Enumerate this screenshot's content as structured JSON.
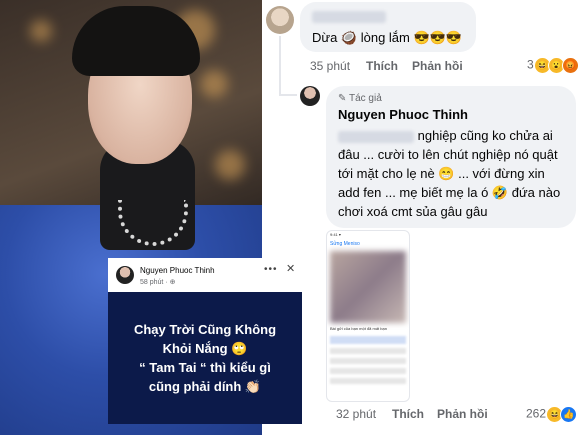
{
  "post_card": {
    "author": "Nguyen Phuoc Thinh",
    "time": "58 phút · ⊕",
    "dots": "•••",
    "close": "✕",
    "banner_lines": [
      "Chạy Trời Cũng Không",
      "Khỏi Nắng 🙄",
      "“ Tam Tai “ thì kiểu gì",
      "cũng phải dính 👏🏻"
    ]
  },
  "comment1": {
    "text": "Dừa 🥥 lòng lắm 😎😎😎",
    "time": "35 phút",
    "like": "Thích",
    "reply": "Phản hồi",
    "react_count": "3",
    "react_emojis": [
      "😆",
      "😮",
      "😡"
    ]
  },
  "comment2": {
    "badge": "✎ Tác giả",
    "author": "Nguyen Phuoc Thinh",
    "lines": [
      "nghiệp cũng ko chửa ai",
      "đâu ... cười to lên chút nghiệp nó quật",
      "tới mặt cho lẹ nè 😁 ... với đừng xin",
      "add fen ... mẹ biết mẹ la ó 🤣 đứa nào",
      "chơi xoá cmt sủa gâu gâu"
    ],
    "time": "32 phút",
    "like": "Thích",
    "reply": "Phản hồi",
    "react_count": "262",
    "react_emojis": [
      "😆",
      "👍"
    ]
  },
  "screenshot_thumb": {
    "title": "Sửng Meniso",
    "caption": "Bài gửi của bạn một đã mất bạn"
  }
}
